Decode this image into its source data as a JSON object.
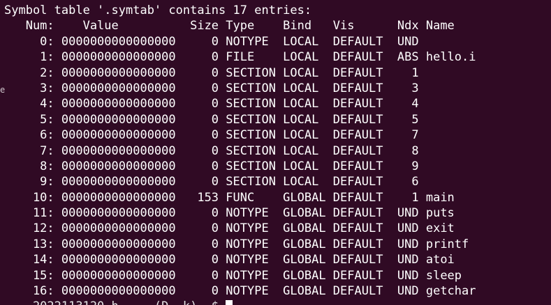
{
  "terminal": {
    "header": "Symbol table '.symtab' contains 17 entries:",
    "columns": "   Num:    Value          Size Type    Bind   Vis      Ndx Name",
    "rows": [
      "     0: 0000000000000000     0 NOTYPE  LOCAL  DEFAULT  UND",
      "     1: 0000000000000000     0 FILE    LOCAL  DEFAULT  ABS hello.i",
      "     2: 0000000000000000     0 SECTION LOCAL  DEFAULT    1",
      "     3: 0000000000000000     0 SECTION LOCAL  DEFAULT    3",
      "     4: 0000000000000000     0 SECTION LOCAL  DEFAULT    4",
      "     5: 0000000000000000     0 SECTION LOCAL  DEFAULT    5",
      "     6: 0000000000000000     0 SECTION LOCAL  DEFAULT    7",
      "     7: 0000000000000000     0 SECTION LOCAL  DEFAULT    8",
      "     8: 0000000000000000     0 SECTION LOCAL  DEFAULT    9",
      "     9: 0000000000000000     0 SECTION LOCAL  DEFAULT    6",
      "    10: 0000000000000000   153 FUNC    GLOBAL DEFAULT    1 main",
      "    11: 0000000000000000     0 NOTYPE  GLOBAL DEFAULT  UND puts",
      "    12: 0000000000000000     0 NOTYPE  GLOBAL DEFAULT  UND exit",
      "    13: 0000000000000000     0 NOTYPE  GLOBAL DEFAULT  UND printf",
      "    14: 0000000000000000     0 NOTYPE  GLOBAL DEFAULT  UND atoi",
      "    15: 0000000000000000     0 NOTYPE  GLOBAL DEFAULT  UND sleep",
      "    16: 0000000000000000     0 NOTYPE  GLOBAL DEFAULT  UND getchar"
    ],
    "prompt_partial": "    2022113120 h     (D  k)  $ ",
    "gutter_mark": "e",
    "colors": {
      "background": "#300a24",
      "foreground": "#ffffff"
    }
  }
}
